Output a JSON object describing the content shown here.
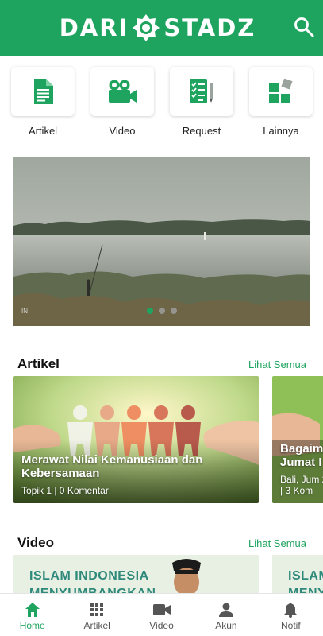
{
  "app": {
    "logo_left": "DARI",
    "logo_right": "STADZ",
    "brand_color": "#1fa45f"
  },
  "menu": [
    {
      "label": "Artikel",
      "icon": "document-icon"
    },
    {
      "label": "Video",
      "icon": "video-camera-icon"
    },
    {
      "label": "Request",
      "icon": "checklist-icon"
    },
    {
      "label": "Lainnya",
      "icon": "more-apps-icon"
    }
  ],
  "banner": {
    "slide_count": 3,
    "active_slide": 1,
    "watermark": "IN"
  },
  "sections": {
    "artikel": {
      "title": "Artikel",
      "see_all": "Lihat Semua"
    },
    "video": {
      "title": "Video",
      "see_all": "Lihat Semua"
    }
  },
  "articles": [
    {
      "title": "Merawat Nilai Kemanusiaan dan Kebersamaan",
      "meta": "Topik 1 | 0 Komentar"
    },
    {
      "title": "Bagaim Jumat I",
      "meta": "Bali, Jum 2 | 3 Kom"
    }
  ],
  "videos": [
    {
      "line1": "ISLAM INDONESIA",
      "line2": "MENYUMBANGKAN"
    },
    {
      "line1": "ISLAM",
      "line2": "MENY"
    }
  ],
  "bottom_nav": [
    {
      "label": "Home",
      "icon": "home-icon",
      "active": true
    },
    {
      "label": "Artikel",
      "icon": "grid-icon",
      "active": false
    },
    {
      "label": "Video",
      "icon": "video-icon",
      "active": false
    },
    {
      "label": "Akun",
      "icon": "user-icon",
      "active": false
    },
    {
      "label": "Notif",
      "icon": "bell-icon",
      "active": false
    }
  ]
}
